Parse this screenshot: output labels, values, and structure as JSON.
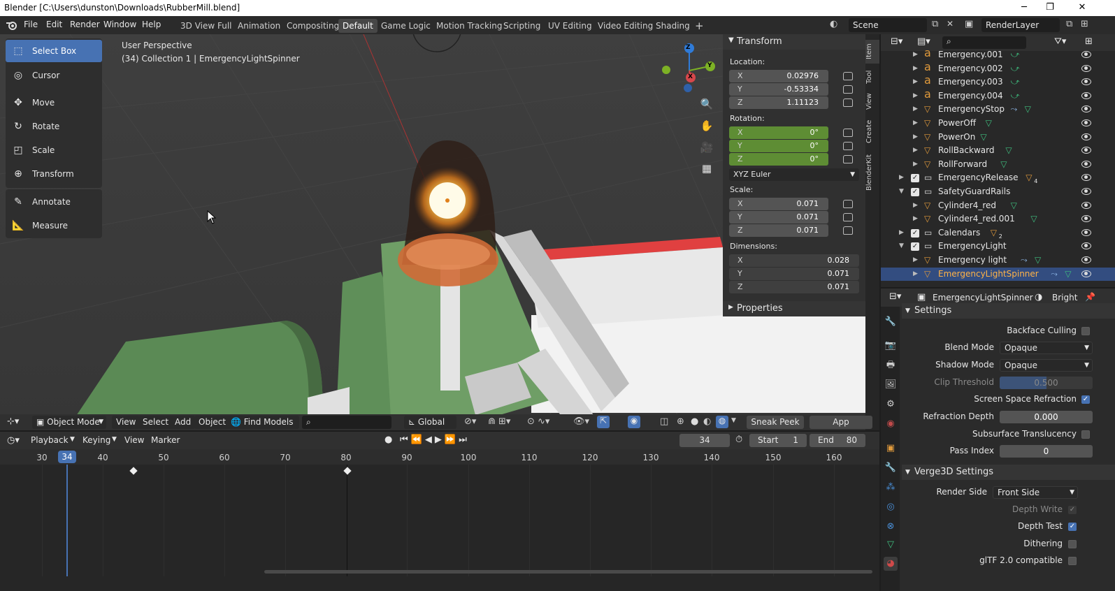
{
  "window": {
    "title": "Blender [C:\\Users\\dunston\\Downloads\\RubberMill.blend]",
    "minimize": "─",
    "maximize": "❐",
    "close": "✕"
  },
  "menu": [
    "File",
    "Edit",
    "Render",
    "Window",
    "Help"
  ],
  "workspaces": [
    "3D View Full",
    "Animation",
    "Compositing",
    "Default",
    "Game Logic",
    "Motion Tracking",
    "Scripting",
    "UV Editing",
    "Video Editing",
    "Shading"
  ],
  "add_workspace": "+",
  "scene": "Scene",
  "view_layer": "RenderLayer",
  "viewport": {
    "perspective": "User Perspective",
    "context": "(34) Collection 1 | EmergencyLightSpinner"
  },
  "tools": [
    "Select Box",
    "Cursor",
    "Move",
    "Rotate",
    "Scale",
    "Transform",
    "Annotate",
    "Measure"
  ],
  "gizmo": {
    "z": "Z",
    "y": "Y",
    "x": "X"
  },
  "npanel": {
    "transform_header": "Transform",
    "location_label": "Location:",
    "location": [
      {
        "axis": "X",
        "value": "0.02976"
      },
      {
        "axis": "Y",
        "value": "-0.53334"
      },
      {
        "axis": "Z",
        "value": "1.11123"
      }
    ],
    "rotation_label": "Rotation:",
    "rotation": [
      {
        "axis": "X",
        "value": "0°"
      },
      {
        "axis": "Y",
        "value": "0°"
      },
      {
        "axis": "Z",
        "value": "0°"
      }
    ],
    "rotation_mode": "XYZ Euler",
    "scale_label": "Scale:",
    "scale": [
      {
        "axis": "X",
        "value": "0.071"
      },
      {
        "axis": "Y",
        "value": "0.071"
      },
      {
        "axis": "Z",
        "value": "0.071"
      }
    ],
    "dimensions_label": "Dimensions:",
    "dimensions": [
      {
        "axis": "X",
        "value": "0.028"
      },
      {
        "axis": "Y",
        "value": "0.071"
      },
      {
        "axis": "Z",
        "value": "0.071"
      }
    ],
    "properties_header": "Properties",
    "tabs": [
      "Item",
      "Tool",
      "View",
      "Create",
      "BlenderKit"
    ]
  },
  "vp_header": {
    "mode": "Object Mode",
    "view": "View",
    "select": "Select",
    "add": "Add",
    "object": "Object",
    "find_models": "Find Models",
    "orientation": "Global",
    "sneak_peek": "Sneak Peek",
    "app_manager": "App Manager"
  },
  "timeline": {
    "menus": [
      "Playback",
      "Keying",
      "View",
      "Marker"
    ],
    "current_frame": "34",
    "start_label": "Start",
    "start": "1",
    "end_label": "End",
    "end": "80",
    "ticks": [
      "30",
      "40",
      "50",
      "60",
      "70",
      "80",
      "90",
      "100",
      "110",
      "120",
      "130",
      "140",
      "150",
      "160"
    ],
    "keyframes": [
      40,
      80
    ]
  },
  "outliner": {
    "rows": [
      {
        "name": "Emergency.001",
        "type": "text"
      },
      {
        "name": "Emergency.002",
        "type": "text"
      },
      {
        "name": "Emergency.003",
        "type": "text"
      },
      {
        "name": "Emergency.004",
        "type": "text"
      },
      {
        "name": "EmergencyStop",
        "type": "mesh"
      },
      {
        "name": "PowerOff",
        "type": "mesh"
      },
      {
        "name": "PowerOn",
        "type": "mesh"
      },
      {
        "name": "RollBackward",
        "type": "mesh"
      },
      {
        "name": "RollForward",
        "type": "mesh"
      },
      {
        "name": "EmergencyRelease",
        "type": "collection",
        "badge": "4"
      },
      {
        "name": "SafetyGuardRails",
        "type": "collection"
      },
      {
        "name": "Cylinder4_red",
        "type": "mesh"
      },
      {
        "name": "Cylinder4_red.001",
        "type": "mesh"
      },
      {
        "name": "Calendars",
        "type": "collection",
        "badge": "2"
      },
      {
        "name": "EmergencyLight",
        "type": "collection"
      },
      {
        "name": "Emergency light",
        "type": "mesh"
      },
      {
        "name": "EmergencyLightSpinner",
        "type": "mesh",
        "selected": true
      }
    ]
  },
  "properties": {
    "object": "EmergencyLightSpinner",
    "material": "Bright",
    "settings_header": "Settings",
    "backface_culling": "Backface Culling",
    "blend_mode_label": "Blend Mode",
    "blend_mode": "Opaque",
    "shadow_mode_label": "Shadow Mode",
    "shadow_mode": "Opaque",
    "clip_threshold_label": "Clip Threshold",
    "clip_threshold": "0.500",
    "ssr": "Screen Space Refraction",
    "refraction_depth_label": "Refraction Depth",
    "refraction_depth": "0.000",
    "sss": "Subsurface Translucency",
    "pass_index_label": "Pass Index",
    "pass_index": "0",
    "verge_header": "Verge3D Settings",
    "render_side_label": "Render Side",
    "render_side": "Front Side",
    "depth_write": "Depth Write",
    "depth_test": "Depth Test",
    "dithering": "Dithering",
    "gltf": "glTF 2.0 compatible"
  }
}
